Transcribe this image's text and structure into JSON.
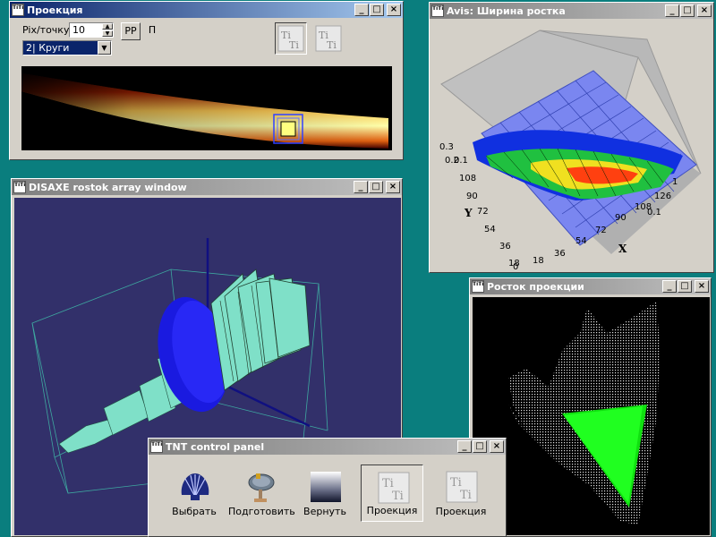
{
  "desktop": {
    "background": "#0a7e7e"
  },
  "proj_window": {
    "title": "Проекция",
    "icon_text": "TiTi",
    "pix_label": "Pix/точку:",
    "pix_value": "10",
    "pp_label": "РР",
    "p_label": "П",
    "mode_selected": "2| Круги"
  },
  "avis_window": {
    "title": "Avis: Ширина ростка",
    "z_ticks": [
      "0.3",
      "0.2",
      "0.1"
    ],
    "z_tick_right": [
      "1",
      "0.1"
    ],
    "y_label": "Y",
    "x_label": "X",
    "y_ticks": [
      "108",
      "90",
      "72",
      "54",
      "36",
      "18",
      "0"
    ],
    "x_ticks": [
      "0",
      "18",
      "36",
      "54",
      "72",
      "90",
      "108",
      "126"
    ]
  },
  "disaxe_window": {
    "title": "DISAXE rostok array window"
  },
  "rostok_window": {
    "title": "Росток проекции"
  },
  "control_panel": {
    "title": "TNT control panel",
    "buttons": [
      {
        "label": "Выбрать",
        "icon": "shell-icon"
      },
      {
        "label": "Подготовить",
        "icon": "satellite-dish-icon"
      },
      {
        "label": "Вернуть",
        "icon": "gradient-icon"
      },
      {
        "label": "Проекция",
        "icon": "tnt-1-2-icon"
      },
      {
        "label": "Проекция",
        "icon": "tnt-3-4-icon"
      }
    ]
  },
  "window_buttons": {
    "minimize": "_",
    "maximize": "□",
    "close": "×"
  }
}
